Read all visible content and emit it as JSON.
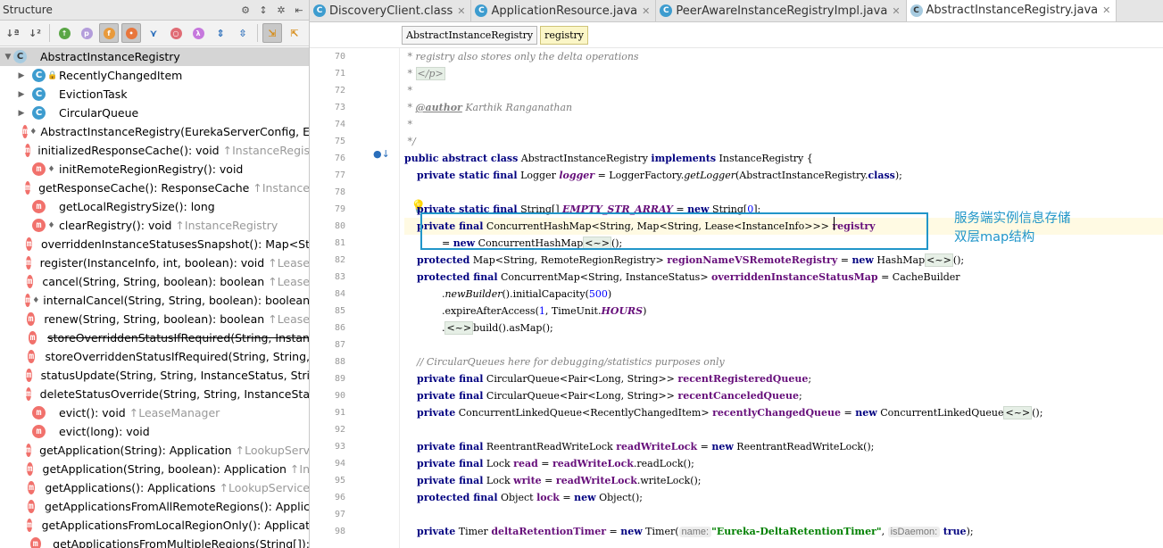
{
  "structure": {
    "title": "Structure",
    "header_icons": [
      "settings-sliders-icon",
      "expand-icon",
      "gear-icon",
      "minimize-icon"
    ],
    "toolbar_icons": [
      "sort-alpha-icon",
      "sort-visibility-icon",
      "show-inherited-icon",
      "show-properties-icon",
      "show-fields-icon",
      "show-non-public-icon",
      "show-lambdas-icon",
      "show-anonymous-icon",
      "show-lambda-icon",
      "expand-all-icon",
      "collapse-all-icon",
      "autoscroll-to-source-icon",
      "autoscroll-from-source-icon"
    ],
    "tree": [
      {
        "label": "AbstractInstanceRegistry",
        "kind": "class",
        "root": true,
        "selected": true
      },
      {
        "label": "RecentlyChangedItem",
        "kind": "class",
        "expandable": true,
        "vis": "lock"
      },
      {
        "label": "EvictionTask",
        "kind": "class",
        "expandable": true
      },
      {
        "label": "CircularQueue",
        "kind": "class",
        "expandable": true
      },
      {
        "label": "AbstractInstanceRegistry(EurekaServerConfig, E",
        "kind": "method",
        "vis": "protected"
      },
      {
        "label": "initializedResponseCache(): void",
        "sup": "↑InstanceRegis",
        "kind": "method"
      },
      {
        "label": "initRemoteRegionRegistry(): void",
        "kind": "method",
        "vis": "protected"
      },
      {
        "label": "getResponseCache(): ResponseCache",
        "sup": "↑Instance",
        "kind": "method"
      },
      {
        "label": "getLocalRegistrySize(): long",
        "kind": "method"
      },
      {
        "label": "clearRegistry(): void",
        "sup": "↑InstanceRegistry",
        "kind": "method",
        "vis": "protected"
      },
      {
        "label": "overriddenInstanceStatusesSnapshot(): Map<St",
        "kind": "method"
      },
      {
        "label": "register(InstanceInfo, int, boolean): void",
        "sup": "↑Lease",
        "kind": "method"
      },
      {
        "label": "cancel(String, String, boolean): boolean",
        "sup": "↑Lease",
        "kind": "method"
      },
      {
        "label": "internalCancel(String, String, boolean): boolean",
        "kind": "method",
        "vis": "protected"
      },
      {
        "label": "renew(String, String, boolean): boolean",
        "sup": "↑Lease",
        "kind": "method"
      },
      {
        "label": "storeOverriddenStatusIfRequired(String, Instan",
        "kind": "method",
        "struck": true
      },
      {
        "label": "storeOverriddenStatusIfRequired(String, String,",
        "kind": "method"
      },
      {
        "label": "statusUpdate(String, String, InstanceStatus, Stri",
        "kind": "method"
      },
      {
        "label": "deleteStatusOverride(String, String, InstanceSta",
        "kind": "method"
      },
      {
        "label": "evict(): void",
        "sup": "↑LeaseManager",
        "kind": "method"
      },
      {
        "label": "evict(long): void",
        "kind": "method"
      },
      {
        "label": "getApplication(String): Application",
        "sup": "↑LookupServ",
        "kind": "method"
      },
      {
        "label": "getApplication(String, boolean): Application",
        "sup": "↑In",
        "kind": "method"
      },
      {
        "label": "getApplications(): Applications",
        "sup": "↑LookupService",
        "kind": "method"
      },
      {
        "label": "getApplicationsFromAllRemoteRegions(): Applic",
        "kind": "method"
      },
      {
        "label": "getApplicationsFromLocalRegionOnly(): Applicat",
        "kind": "method"
      },
      {
        "label": "getApplicationsFromMultipleRegions(String[]):",
        "kind": "method"
      }
    ]
  },
  "tabs": [
    {
      "label": "DiscoveryClient.class",
      "active": false
    },
    {
      "label": "ApplicationResource.java",
      "active": false
    },
    {
      "label": "PeerAwareInstanceRegistryImpl.java",
      "active": false
    },
    {
      "label": "AbstractInstanceRegistry.java",
      "active": true
    }
  ],
  "breadcrumbs": [
    "AbstractInstanceRegistry",
    "registry"
  ],
  "line_numbers": [
    "70",
    "71",
    "72",
    "73",
    "74",
    "75",
    "76",
    "77",
    "78",
    "79",
    "80",
    "81",
    "82",
    "83",
    "84",
    "85",
    "86",
    "87",
    "88",
    "89",
    "90",
    "91",
    "92",
    "93",
    "94",
    "95",
    "96",
    "97",
    "98"
  ],
  "code": {
    "l70": " * registry also stores only the delta operations",
    "l71a": " * ",
    "l71b": "</p>",
    "l72": " *",
    "l73a": " * ",
    "l73tag": "@author",
    "l73b": " Karthik Ranganathan",
    "l74": " *",
    "l75": " */",
    "l76_kw1": "public abstract class",
    "l76_mid": " AbstractInstanceRegistry ",
    "l76_kw2": "implements",
    "l76_end": " InstanceRegistry {",
    "l77_kw": "private static final",
    "l77_type": " Logger ",
    "l77_field": "logger",
    "l77_eq": " = LoggerFactory.",
    "l77_m": "getLogger",
    "l77_arg": "(AbstractInstanceRegistry.",
    "l77_cls": "class",
    "l77_end": ");",
    "l79_kw": "private static final",
    "l79_type": " String[] ",
    "l79_field": "EMPTY_STR_ARRAY",
    "l79_eq": " = ",
    "l79_new": "new",
    "l79_t2": " String[",
    "l79_num": "0",
    "l79_end": "];",
    "l80_kw": "private final",
    "l80_type": " ConcurrentHashMap<String, Map<String, Lease<InstanceInfo>>> ",
    "l80_field": "registry",
    "l81_eq": "= ",
    "l81_new": "new",
    "l81_t": " ConcurrentHashMap",
    "l81_d": "<~>",
    "l81_end": "();",
    "l82_kw": "protected",
    "l82_type": " Map<String, RemoteRegionRegistry> ",
    "l82_field": "regionNameVSRemoteRegistry",
    "l82_eq": " = ",
    "l82_new": "new",
    "l82_t2": " HashMap",
    "l82_d": "<~>",
    "l82_end": "();",
    "l83_kw": "protected final",
    "l83_type": " ConcurrentMap<String, InstanceStatus> ",
    "l83_field": "overriddenInstanceStatusMap",
    "l83_end": " = CacheBuilder",
    "l84_a": ".",
    "l84_m": "newBuilder",
    "l84_b": "().initialCapacity(",
    "l84_num": "500",
    "l84_end": ")",
    "l85_a": ".expireAfterAccess(",
    "l85_num": "1",
    "l85_b": ", TimeUnit.",
    "l85_f": "HOURS",
    "l85_end": ")",
    "l86_a": ".",
    "l86_d": "<~>",
    "l86_end": "build().asMap();",
    "l88": "// CircularQueues here for debugging/statistics purposes only",
    "l89_kw": "private final",
    "l89_type": " CircularQueue<Pair<Long, String>> ",
    "l89_field": "recentRegisteredQueue",
    "l89_end": ";",
    "l90_kw": "private final",
    "l90_type": " CircularQueue<Pair<Long, String>> ",
    "l90_field": "recentCanceledQueue",
    "l90_end": ";",
    "l91_kw": "private",
    "l91_type": " ConcurrentLinkedQueue<RecentlyChangedItem> ",
    "l91_field": "recentlyChangedQueue",
    "l91_eq": " = ",
    "l91_new": "new",
    "l91_t2": " ConcurrentLinkedQueue",
    "l91_d": "<~>",
    "l91_end": "();",
    "l93_kw": "private final",
    "l93_type": " ReentrantReadWriteLock ",
    "l93_field": "readWriteLock",
    "l93_eq": " = ",
    "l93_new": "new",
    "l93_end": " ReentrantReadWriteLock();",
    "l94_kw": "private final",
    "l94_type": " Lock ",
    "l94_field": "read",
    "l94_eq": " = ",
    "l94_f2": "readWriteLock",
    "l94_end": ".readLock();",
    "l95_kw": "private final",
    "l95_type": " Lock ",
    "l95_field": "write",
    "l95_eq": " = ",
    "l95_f2": "readWriteLock",
    "l95_end": ".writeLock();",
    "l96_kw": "protected final",
    "l96_type": " Object ",
    "l96_field": "lock",
    "l96_eq": " = ",
    "l96_new": "new",
    "l96_end": " Object();",
    "l98_kw": "private",
    "l98_type": " Timer ",
    "l98_field": "deltaRetentionTimer",
    "l98_eq": " = ",
    "l98_new": "new",
    "l98_t2": " Timer(",
    "l98_h1": "name:",
    "l98_s": "\"Eureka-DeltaRetentionTimer\"",
    "l98_c": ", ",
    "l98_h2": "isDaemon:",
    "l98_true": "true",
    "l98_end": ");"
  },
  "annotation": {
    "line1": "服务端实例信息存储",
    "line2": "双层map结构",
    "color": "#2196c9"
  }
}
